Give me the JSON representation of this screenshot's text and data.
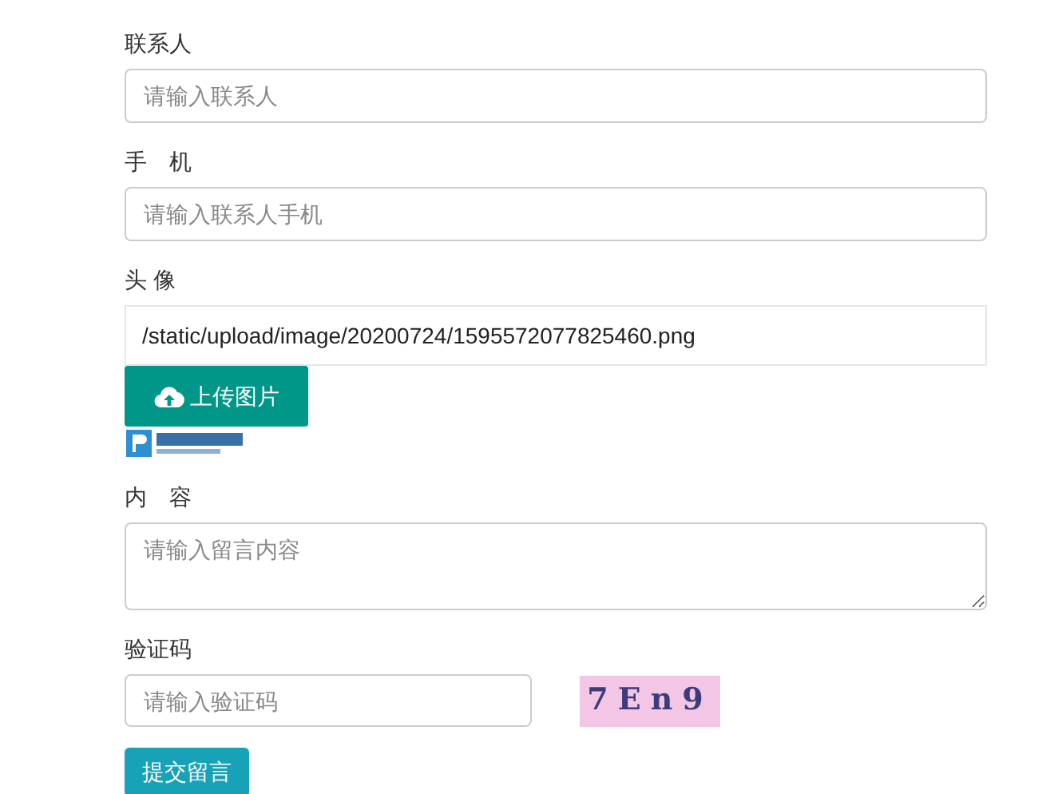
{
  "fields": [
    {
      "kind": "input",
      "label": "联系人",
      "placeholder": "请输入联系人"
    },
    {
      "kind": "input",
      "label": "手　机",
      "placeholder": "请输入联系人手机"
    },
    {
      "kind": "upload",
      "label": "头 像",
      "value": "/static/upload/image/20200724/1595572077825460.png",
      "button": "上传图片"
    },
    {
      "kind": "textarea",
      "label": "内　容",
      "placeholder": "请输入留言内容"
    },
    {
      "kind": "captcha",
      "label": "验证码",
      "placeholder": "请输入验证码",
      "captcha": "7En9"
    }
  ],
  "submit": "提交留言"
}
